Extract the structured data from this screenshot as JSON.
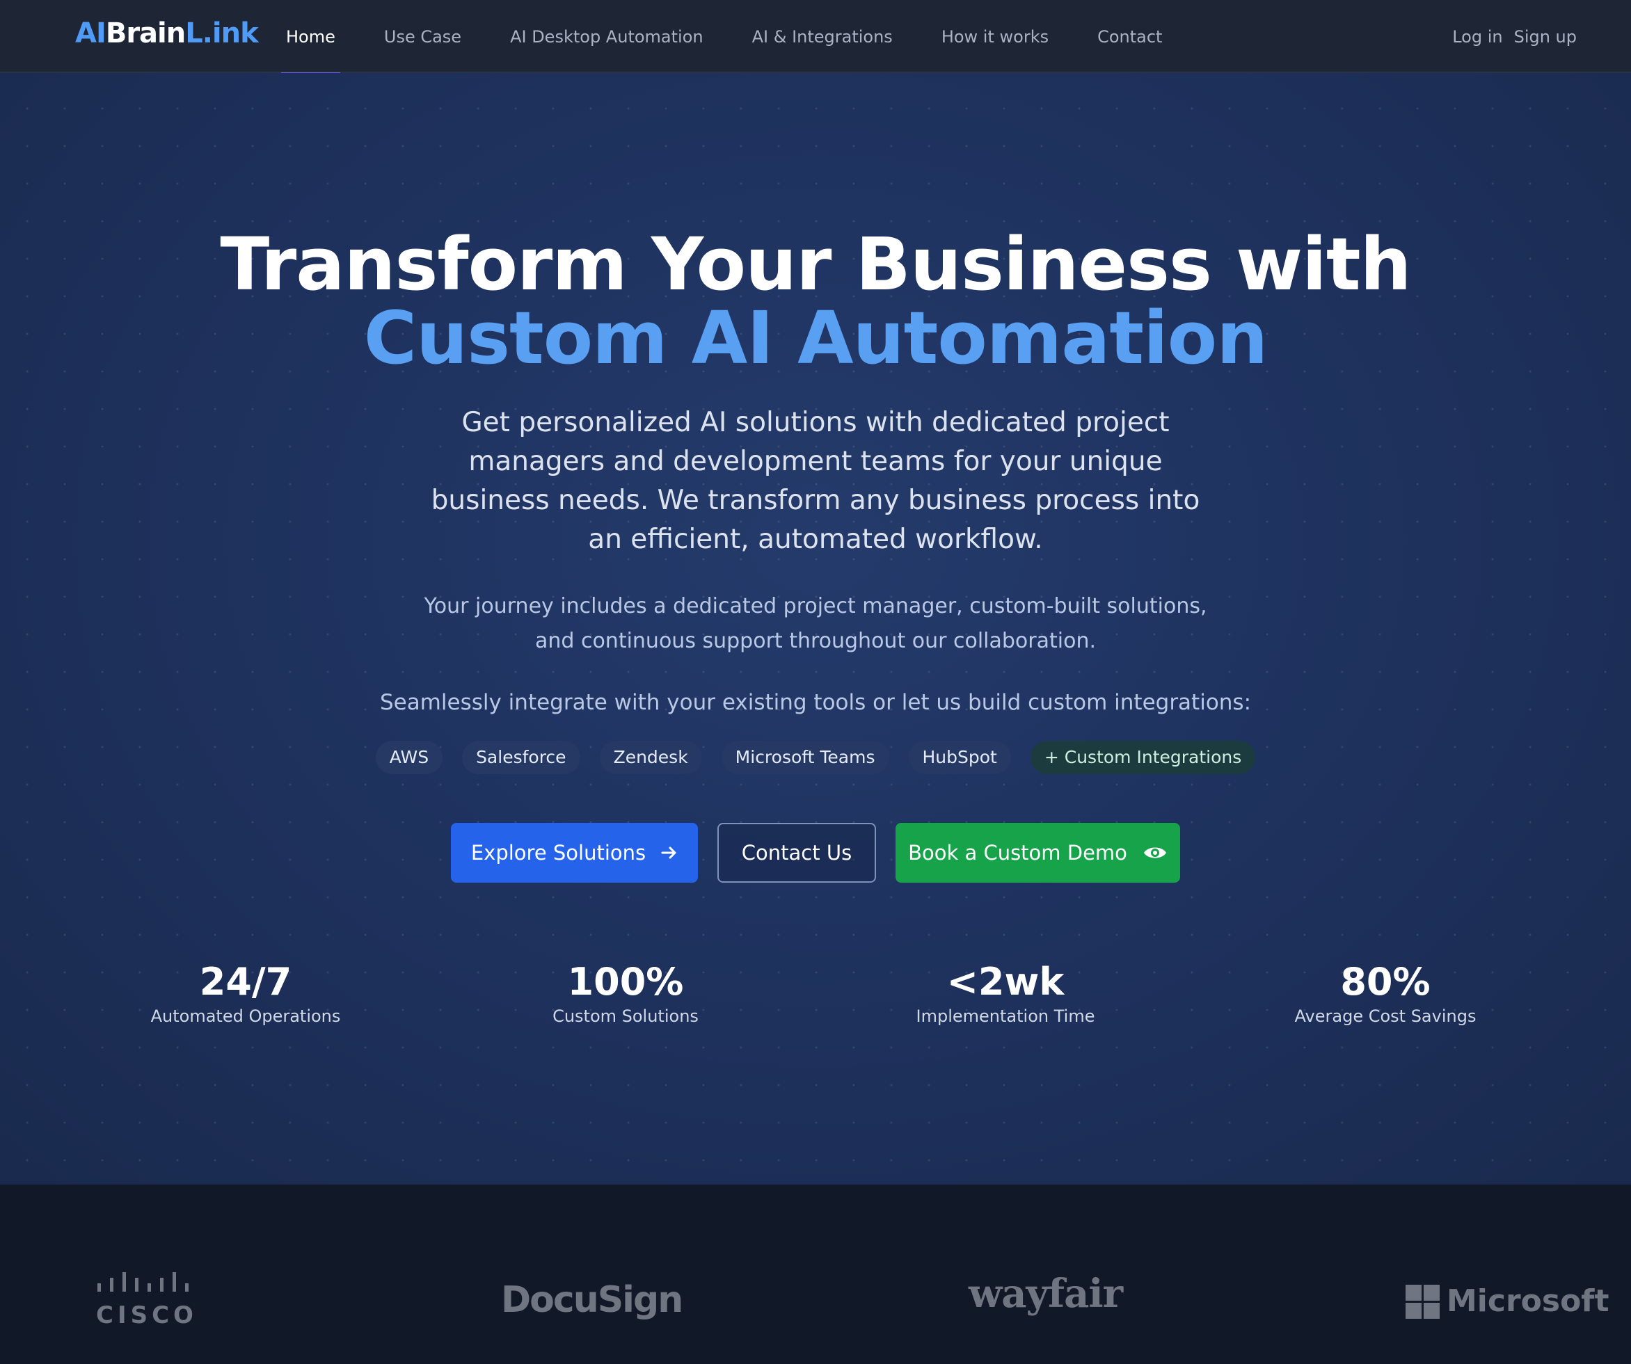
{
  "nav": {
    "logo": {
      "part1": "AI",
      "part2": "Brain",
      "part3": "L.ink"
    },
    "links": [
      {
        "label": "Home",
        "active": true
      },
      {
        "label": "Use Case",
        "active": false
      },
      {
        "label": "AI Desktop Automation",
        "active": false
      },
      {
        "label": "AI & Integrations",
        "active": false
      },
      {
        "label": "How it works",
        "active": false
      },
      {
        "label": "Contact",
        "active": false
      }
    ],
    "login": "Log in",
    "signup": "Sign up"
  },
  "hero": {
    "title_line1": "Transform Your Business with",
    "title_line2": "Custom AI Automation",
    "subtitle": "Get personalized AI solutions with dedicated project managers and development teams for your unique business needs. We transform any business process into an efficient, automated workflow.",
    "journey": "Your journey includes a dedicated project manager, custom-built solutions, and continuous support throughout our collaboration.",
    "integrate_text": "Seamlessly integrate with your existing tools or let us build custom integrations:",
    "chips": [
      "AWS",
      "Salesforce",
      "Zendesk",
      "Microsoft Teams",
      "HubSpot",
      "+ Custom Integrations"
    ],
    "buttons": {
      "explore": "Explore Solutions",
      "contact": "Contact Us",
      "demo": "Book a Custom Demo"
    }
  },
  "stats": [
    {
      "value": "24/7",
      "label": "Automated Operations"
    },
    {
      "value": "100%",
      "label": "Custom Solutions"
    },
    {
      "value": "<2wk",
      "label": "Implementation Time"
    },
    {
      "value": "80%",
      "label": "Average Cost Savings"
    }
  ],
  "brands": {
    "cisco": "CISCO",
    "docusign": "DocuSign",
    "wayfair": "wayfair",
    "microsoft": "Microsoft"
  },
  "colors": {
    "accent_blue": "#2563eb",
    "title_blue": "#5aa0f2",
    "demo_green": "#16a34a",
    "nav_bg": "#1e2535",
    "footer_bg": "#111827"
  }
}
